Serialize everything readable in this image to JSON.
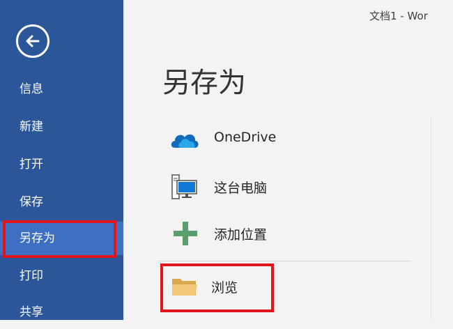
{
  "window": {
    "title": "文档1 - Wor"
  },
  "sidebar": {
    "back_icon": "back-arrow-circle-icon",
    "items": [
      {
        "label": "信息",
        "selected": false
      },
      {
        "label": "新建",
        "selected": false
      },
      {
        "label": "打开",
        "selected": false
      },
      {
        "label": "保存",
        "selected": false
      },
      {
        "label": "另存为",
        "selected": true
      },
      {
        "label": "打印",
        "selected": false
      },
      {
        "label": "共享",
        "selected": false
      }
    ],
    "bg_color": "#2b579a",
    "selected_color": "#3d6fc2"
  },
  "main": {
    "title": "另存为",
    "locations": [
      {
        "label": "OneDrive",
        "icon": "onedrive-cloud-icon"
      },
      {
        "label": "这台电脑",
        "icon": "this-pc-icon"
      },
      {
        "label": "添加位置",
        "icon": "add-place-icon"
      },
      {
        "label": "浏览",
        "icon": "folder-icon"
      }
    ]
  },
  "highlight_color": "#e2141c"
}
